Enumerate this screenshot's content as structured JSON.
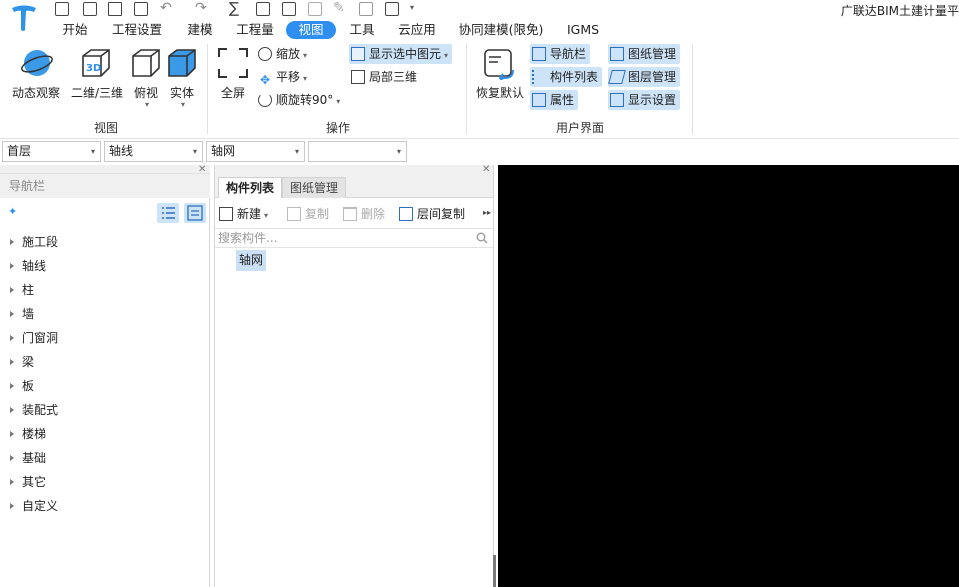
{
  "app": {
    "title": "广联达BIM土建计量平"
  },
  "menu": {
    "tabs": [
      "开始",
      "工程设置",
      "建模",
      "工程量",
      "视图",
      "工具",
      "云应用",
      "协同建模(限免)",
      "IGMS"
    ],
    "active_index": 4
  },
  "ribbon": {
    "view_group": {
      "label": "视图",
      "buttons": [
        "动态观察",
        "二维/三维",
        "俯视",
        "实体"
      ]
    },
    "operation_group": {
      "label": "操作",
      "fullscreen": "全屏",
      "zoom": "缩放",
      "pan": "平移",
      "rotate": "顺旋转90°",
      "show_selected": "显示选中图元",
      "local_3d": "局部三维"
    },
    "ui_group": {
      "label": "用户界面",
      "restore": "恢复默认",
      "nav_bar": "导航栏",
      "component_list": "构件列表",
      "properties": "属性",
      "drawing_mgmt": "图纸管理",
      "layer_mgmt": "图层管理",
      "display_settings": "显示设置"
    }
  },
  "combos": {
    "floor": "首层",
    "category": "轴线",
    "type": "轴网",
    "extra": ""
  },
  "nav": {
    "title": "导航栏",
    "items": [
      "施工段",
      "轴线",
      "柱",
      "墙",
      "门窗洞",
      "梁",
      "板",
      "装配式",
      "楼梯",
      "基础",
      "其它",
      "自定义"
    ]
  },
  "components": {
    "tabs": [
      "构件列表",
      "图纸管理"
    ],
    "toolbar": {
      "new": "新建",
      "copy": "复制",
      "delete": "删除",
      "floor_copy": "层间复制"
    },
    "search_placeholder": "搜索构件...",
    "items": [
      "轴网"
    ]
  },
  "colors": {
    "accent": "#2e8ff0",
    "selected_bg": "#cde3f8",
    "viewport": "#000000",
    "icon_blue": "#3a9ae8"
  }
}
